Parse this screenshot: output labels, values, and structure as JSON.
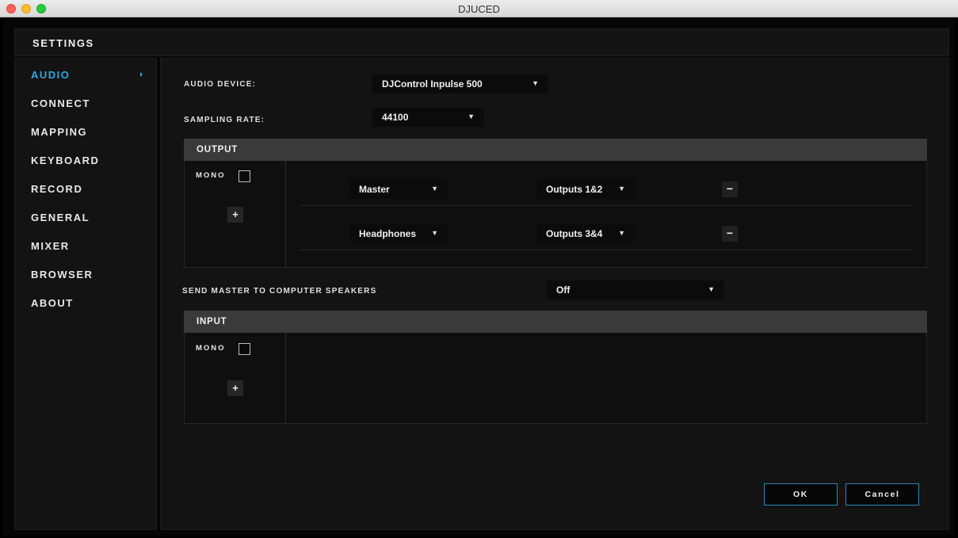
{
  "window": {
    "title": "DJUCED"
  },
  "header": {
    "title": "SETTINGS"
  },
  "sidebar": {
    "items": [
      {
        "label": "AUDIO",
        "active": true
      },
      {
        "label": "CONNECT"
      },
      {
        "label": "MAPPING"
      },
      {
        "label": "KEYBOARD"
      },
      {
        "label": "RECORD"
      },
      {
        "label": "GENERAL"
      },
      {
        "label": "MIXER"
      },
      {
        "label": "BROWSER"
      },
      {
        "label": "ABOUT"
      }
    ]
  },
  "audio": {
    "device_label": "AUDIO DEVICE:",
    "device_value": "DJControl Inpulse 500",
    "sampling_label": "SAMPLING RATE:",
    "sampling_value": "44100"
  },
  "output": {
    "title": "OUTPUT",
    "mono_label": "MONO",
    "mono_checked": false,
    "add_label": "+",
    "rows": [
      {
        "channel": "Master",
        "route": "Outputs 1&2",
        "remove_label": "−"
      },
      {
        "channel": "Headphones",
        "route": "Outputs 3&4",
        "remove_label": "−"
      }
    ]
  },
  "send_master": {
    "label": "SEND MASTER TO COMPUTER SPEAKERS",
    "value": "Off"
  },
  "input": {
    "title": "INPUT",
    "mono_label": "MONO",
    "mono_checked": false,
    "add_label": "+"
  },
  "footer": {
    "ok_label": "OK",
    "cancel_label": "Cancel"
  },
  "icons": {
    "dropdown_arrow": "▼"
  },
  "colors": {
    "accent": "#2ea8dc",
    "button_border": "#2f86b6",
    "section_bar": "#3a3a3a"
  }
}
